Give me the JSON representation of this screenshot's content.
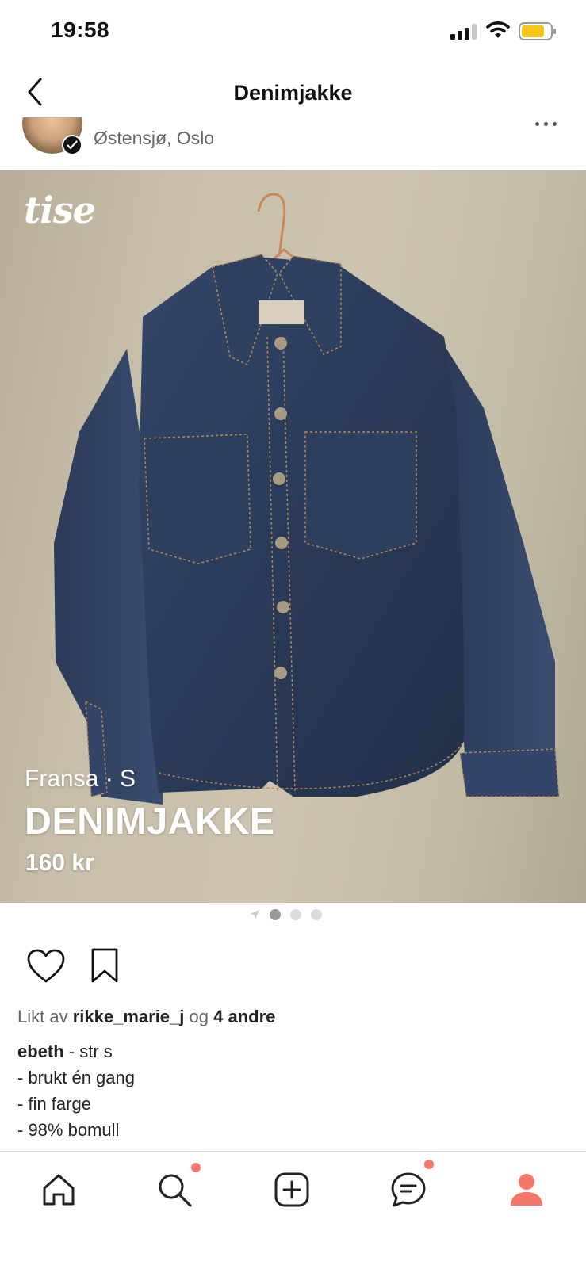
{
  "status_bar": {
    "time": "19:58"
  },
  "header": {
    "title": "Denimjakke",
    "back_icon": "chevron-left-icon"
  },
  "seller": {
    "location": "Østensjø, Oslo",
    "verified": true
  },
  "product": {
    "watermark": "tise",
    "brand_size": "Fransa · S",
    "title": "DENIMJAKKE",
    "price": "160 kr",
    "image_count": 3,
    "active_image": 1
  },
  "likes": {
    "prefix": "Likt av",
    "user": "rikke_marie_j",
    "joiner": "og",
    "others": "4 andre"
  },
  "description": {
    "author": "ebeth",
    "first_line": " - str s",
    "lines": [
      "- brukt én gang",
      "- fin farge",
      "- 98% bomull"
    ]
  },
  "tabbar": {
    "items": [
      {
        "name": "home-icon",
        "badge": false
      },
      {
        "name": "search-icon",
        "badge": true
      },
      {
        "name": "add-icon",
        "badge": false
      },
      {
        "name": "messages-icon",
        "badge": true
      },
      {
        "name": "profile-icon",
        "badge": false
      }
    ]
  },
  "colors": {
    "accent": "#f7786a",
    "denim": "#2c3b55",
    "battery": "#f5c518"
  }
}
